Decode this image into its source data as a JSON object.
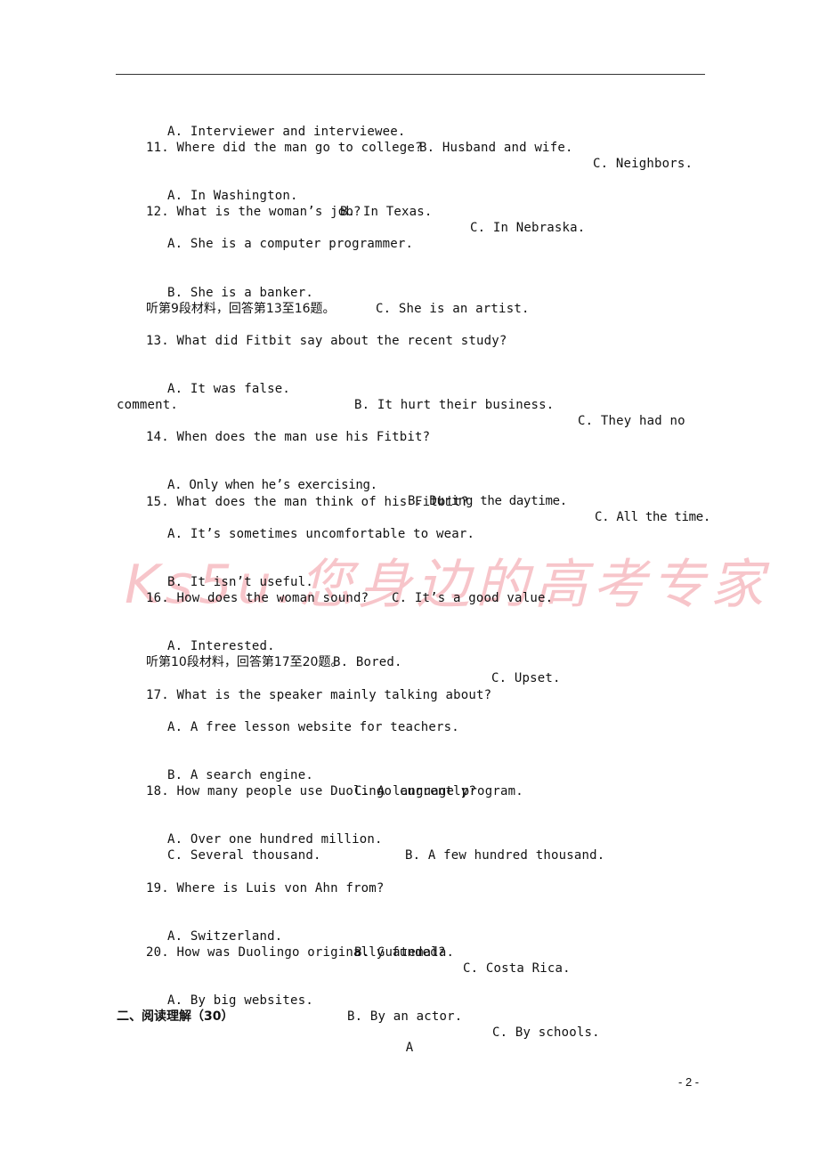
{
  "watermark": "Ks5u.您身边的高考专家",
  "q10_options": [
    "A. Interviewer and interviewee.",
    "B. Husband and wife.",
    "C. Neighbors."
  ],
  "q11": {
    "question": "11. Where did the man go to college?",
    "options": [
      "A. In Washington.",
      "B. In Texas.",
      "C. In Nebraska."
    ]
  },
  "q12": {
    "question": "12. What is the woman’s job?",
    "options": [
      "A. She is a computer programmer.",
      "B. She is a banker.",
      "C. She is an artist."
    ]
  },
  "section9": "听第9段材料，回答第13至16题。",
  "q13": {
    "question": "13. What did Fitbit say about the recent study?",
    "options": [
      "A. It was false.",
      "B. It hurt their business.",
      "C. They had no"
    ],
    "wrap": "comment."
  },
  "q14": {
    "question": "14. When does the man use his Fitbit?",
    "options": [
      "A. Only when he’s exercising.",
      "B. During the daytime.",
      "C. All the time."
    ]
  },
  "q15": {
    "question": "15. What does the man think of his Fitbit?",
    "options": [
      "A. It’s sometimes uncomfortable to wear.",
      "B. It isn’t useful.",
      "C. It’s a good value."
    ]
  },
  "q16": {
    "question": "16. How does the woman sound?",
    "options": [
      "A. Interested.",
      "B. Bored.",
      "C. Upset."
    ]
  },
  "section10": "听第10段材料，回答第17至20题。",
  "q17": {
    "question": "17. What is the speaker mainly talking about?",
    "options": [
      "A. A free lesson website for teachers.",
      "B. A search engine.",
      "C. A language program."
    ]
  },
  "q18": {
    "question": "18. How many people use Duolingo currently?",
    "options": [
      "A. Over one hundred million.",
      "B. A few hundred thousand.",
      "C. Several thousand."
    ]
  },
  "q19": {
    "question": "19. Where is Luis von Ahn from?",
    "options": [
      "A. Switzerland.",
      "B. Guatemala.",
      "C. Costa Rica."
    ]
  },
  "q20": {
    "question": "20. How was Duolingo originally funded?",
    "options": [
      "A. By big websites.",
      "B. By an actor.",
      "C. By schools."
    ]
  },
  "part2_heading": "二、阅读理解（30）",
  "passage_label": "A",
  "page_number": "- 2 -"
}
